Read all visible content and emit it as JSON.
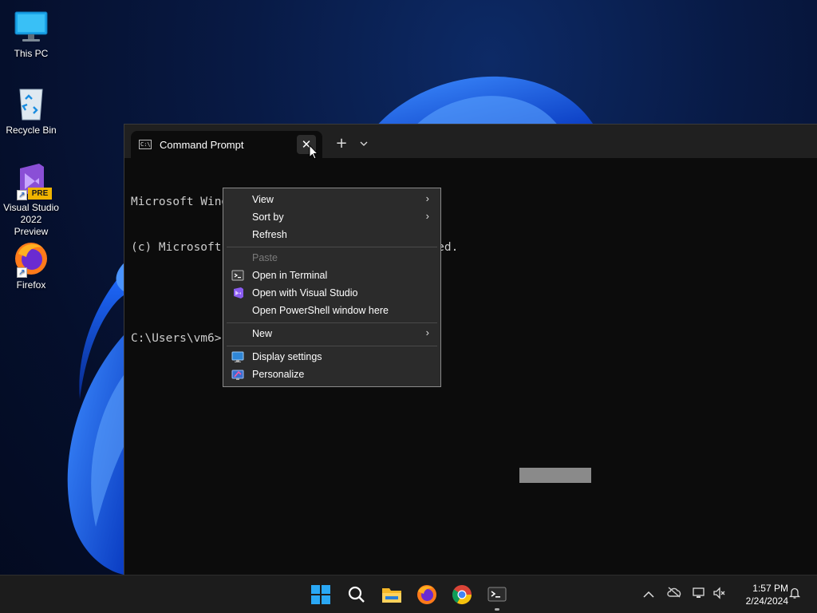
{
  "desktop": {
    "icons": [
      {
        "label": "This PC"
      },
      {
        "label": "Recycle Bin"
      },
      {
        "label": "Visual Studio\n2022 Preview",
        "line1": "Visual Studio",
        "line2": "2022 Preview",
        "badge": "PRE"
      },
      {
        "label": "Firefox"
      }
    ]
  },
  "terminal": {
    "tab_title": "Command Prompt",
    "tab_icon_text": "C:\\",
    "close_glyph": "✕",
    "newtab_glyph": "+",
    "dropdown_glyph": "⌄",
    "lines": [
      "Microsoft Windows [Version 10.0.26040.1000]",
      "(c) Microsoft Corporation. All rights reserved.",
      "",
      "C:\\Users\\vm6>"
    ]
  },
  "context_menu": {
    "items": [
      {
        "label": "View",
        "submenu": true
      },
      {
        "label": "Sort by",
        "submenu": true
      },
      {
        "label": "Refresh"
      },
      {
        "label": "Paste",
        "disabled": true
      },
      {
        "label": "Open in Terminal",
        "icon": "terminal-icon"
      },
      {
        "label": "Open with Visual Studio",
        "icon": "visual-studio-icon"
      },
      {
        "label": "Open PowerShell window here"
      },
      {
        "label": "New",
        "submenu": true
      },
      {
        "label": "Display settings",
        "icon": "display-icon"
      },
      {
        "label": "Personalize",
        "icon": "personalize-icon"
      }
    ],
    "arrow_glyph": "›"
  },
  "taskbar": {
    "clock_time": "1:57 PM",
    "clock_date": "2/24/2024",
    "tray_chevron": "^"
  },
  "colors": {
    "accent": "#0078d4",
    "menu_bg": "#2b2b2b",
    "terminal_bg": "#0c0c0c",
    "taskbar_bg": "#1c1c1c"
  }
}
